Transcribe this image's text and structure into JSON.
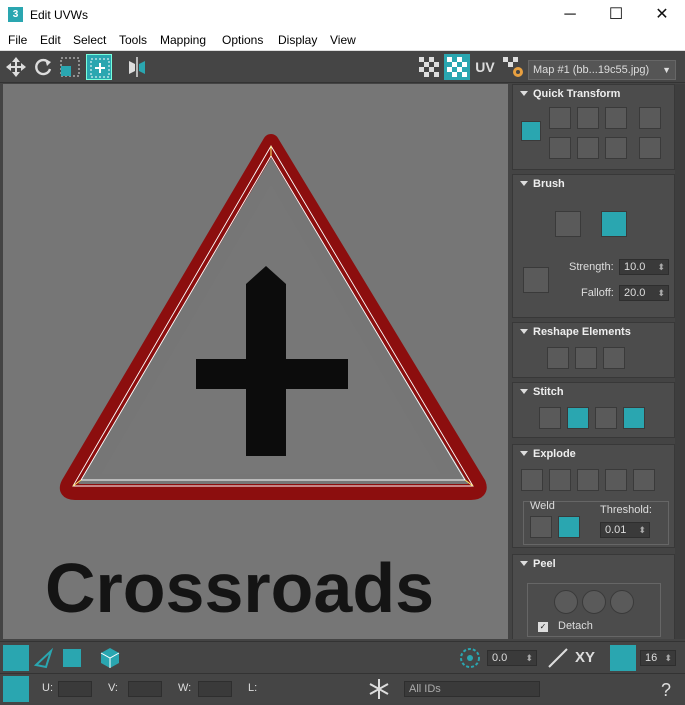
{
  "window": {
    "title": "Edit UVWs",
    "app_icon": "3"
  },
  "winbtns": {
    "minimize": "─",
    "maximize": "☐",
    "close": "✕"
  },
  "menu": [
    "File",
    "Edit",
    "Select",
    "Tools",
    "Mapping",
    "Options",
    "Display",
    "View"
  ],
  "toolbar": {
    "uv_label": "UV",
    "map_dropdown": "Map #1 (bb...19c55.jpg)"
  },
  "viewport": {
    "texture_text": "Crossroads"
  },
  "rollouts": {
    "quick_transform": "Quick Transform",
    "brush": {
      "title": "Brush",
      "strength_label": "Strength:",
      "strength_value": "10.0",
      "falloff_label": "Falloff:",
      "falloff_value": "20.0"
    },
    "reshape": "Reshape Elements",
    "stitch": "Stitch",
    "explode": {
      "title": "Explode",
      "weld_label": "Weld",
      "threshold_label": "Threshold:",
      "threshold_value": "0.01"
    },
    "peel": {
      "title": "Peel",
      "detach_label": "Detach"
    }
  },
  "bottom": {
    "angle_value": "0.0",
    "xy_label": "XY",
    "grid_value": "16",
    "u_label": "U:",
    "v_label": "V:",
    "w_label": "W:",
    "l_label": "L:",
    "ids_dropdown": "All IDs"
  },
  "colors": {
    "accent": "#2aa6b0",
    "panel": "#444444",
    "viewport": "#757575"
  }
}
